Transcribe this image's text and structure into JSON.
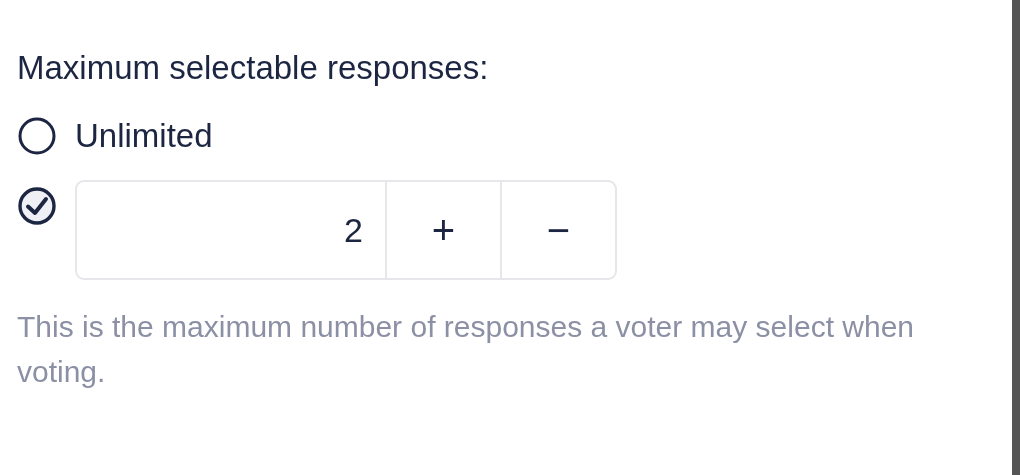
{
  "heading": "Maximum selectable responses:",
  "options": [
    {
      "kind": "label",
      "label": "Unlimited",
      "selected": false
    },
    {
      "kind": "stepper",
      "selected": true,
      "value": "2",
      "increment": "+",
      "decrement": "−"
    }
  ],
  "help": "This is the maximum number of responses a voter may select when voting."
}
